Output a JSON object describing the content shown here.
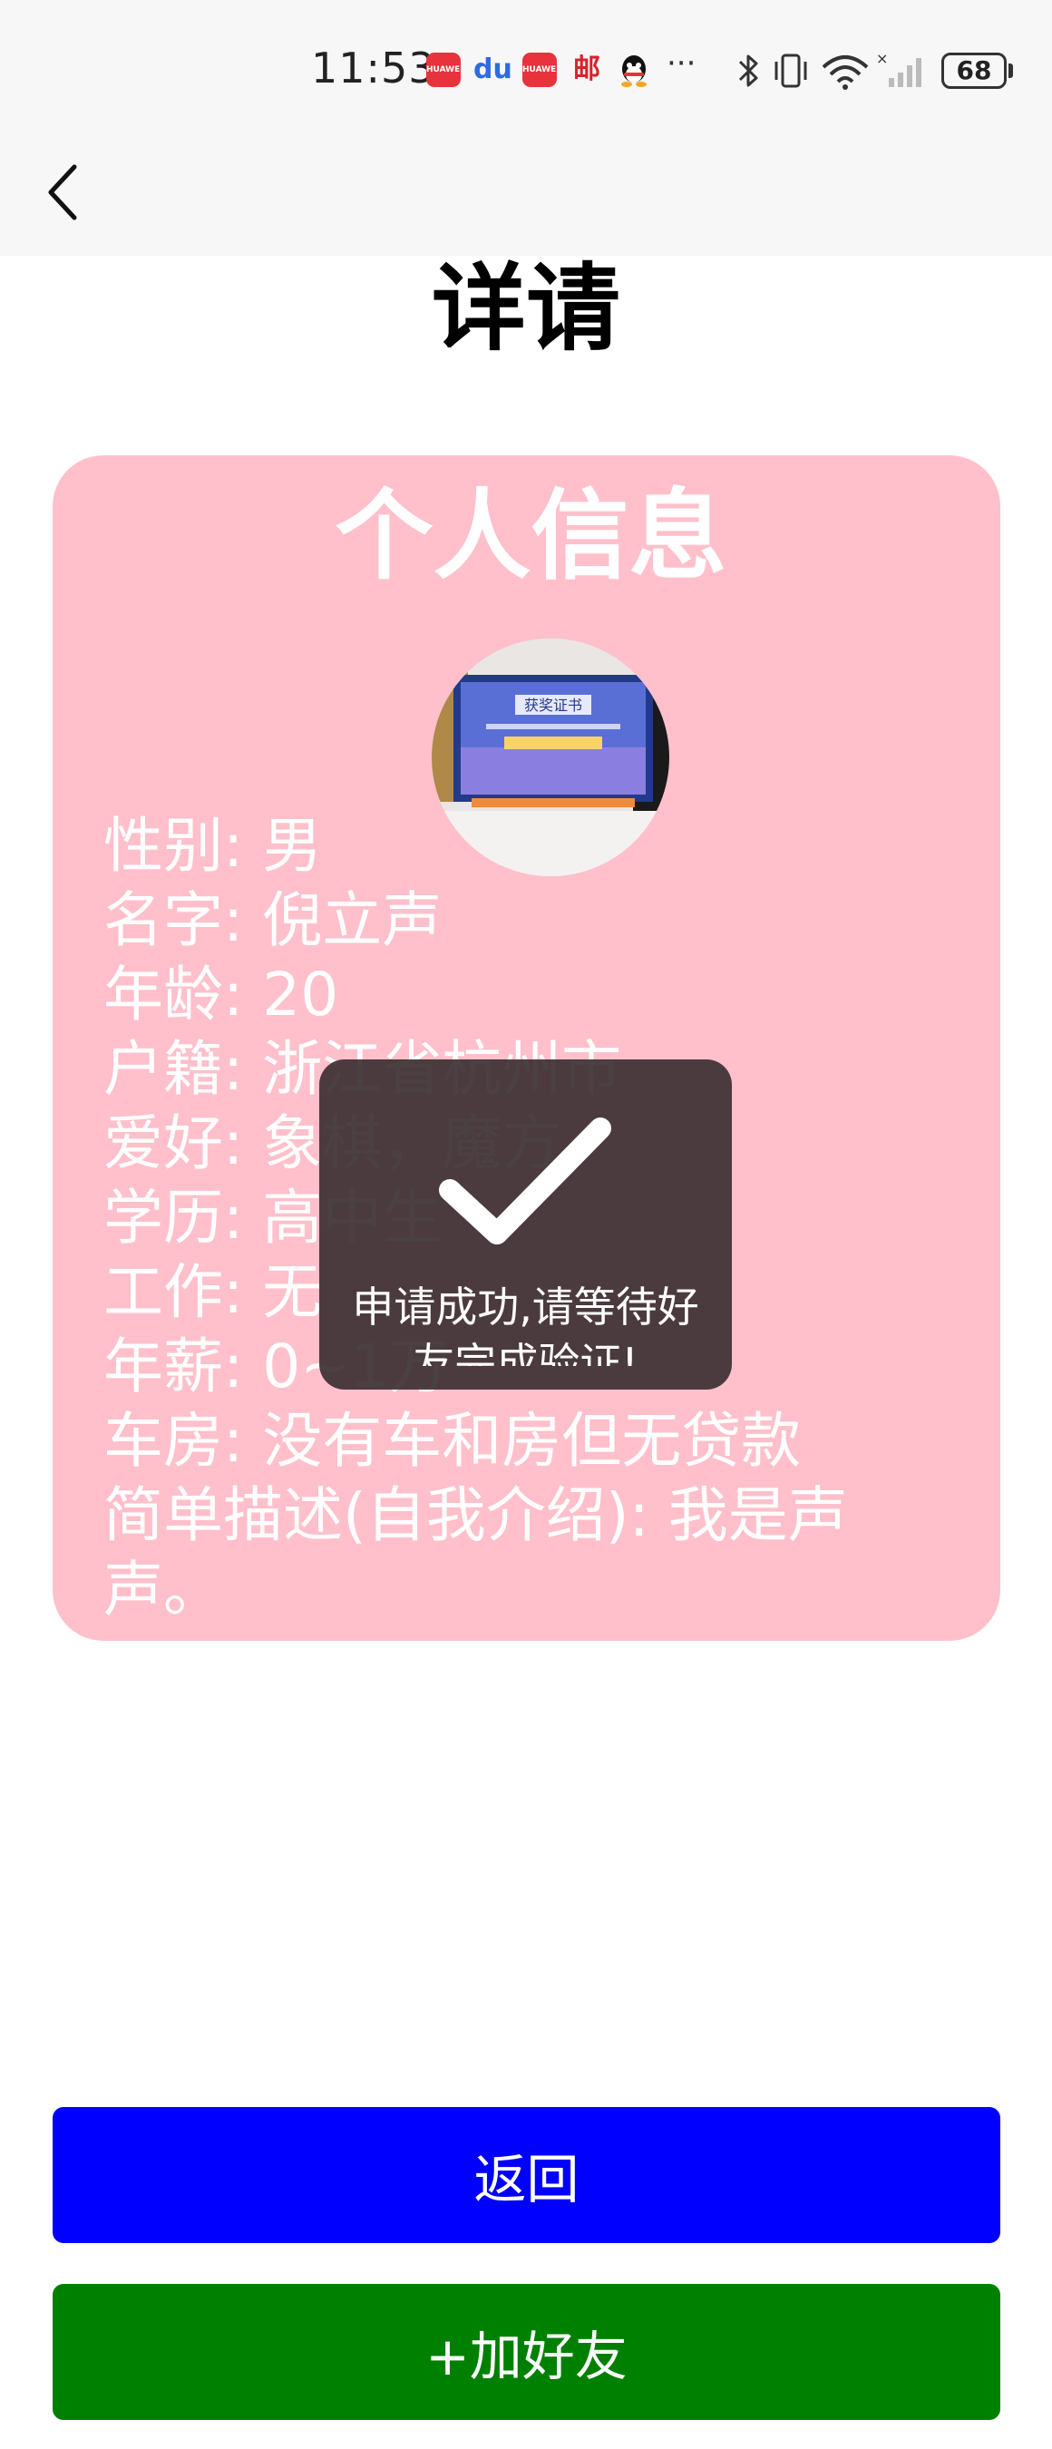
{
  "status_bar": {
    "time": "11:53",
    "notification_icons": [
      "huawei-app-icon",
      "baidu-icon",
      "huawei-app-icon",
      "post-icon",
      "qq-icon"
    ],
    "notif_labels": {
      "huawei": "HUAWEI",
      "baidu": "du",
      "post": "邮"
    },
    "more": "···",
    "system_icons": [
      "bluetooth-icon",
      "vibrate-icon",
      "wifi-icon",
      "cellular-signal-icon"
    ],
    "battery": "68"
  },
  "header": {
    "back_icon": "chevron-left-icon"
  },
  "page": {
    "title": "详请"
  },
  "card": {
    "title": "个人信息",
    "background": "#ffc0cb",
    "avatar_alt": "certificate-photo",
    "avatar_image_text": "获奖证书",
    "fields": [
      {
        "label": "性别",
        "value": "男"
      },
      {
        "label": "名字",
        "value": "倪立声"
      },
      {
        "label": "年龄",
        "value": "20"
      },
      {
        "label": "户籍",
        "value": "浙江省杭州市"
      },
      {
        "label": "爱好",
        "value": "象棋，魔方"
      },
      {
        "label": "学历",
        "value": "高中生"
      },
      {
        "label": "工作",
        "value": "无"
      },
      {
        "label": "年薪",
        "value": "0~1万"
      },
      {
        "label": "车房",
        "value": "没有车和房但无贷款"
      },
      {
        "label": "简单描述(自我介绍)",
        "value": "我是声声。"
      }
    ]
  },
  "toast": {
    "icon": "checkmark-icon",
    "message": "申请成功,请等待好友完成验证!"
  },
  "buttons": {
    "back_label": "返回",
    "back_color": "#0000ff",
    "add_friend_label": "+加好友",
    "add_friend_color": "#008000"
  }
}
